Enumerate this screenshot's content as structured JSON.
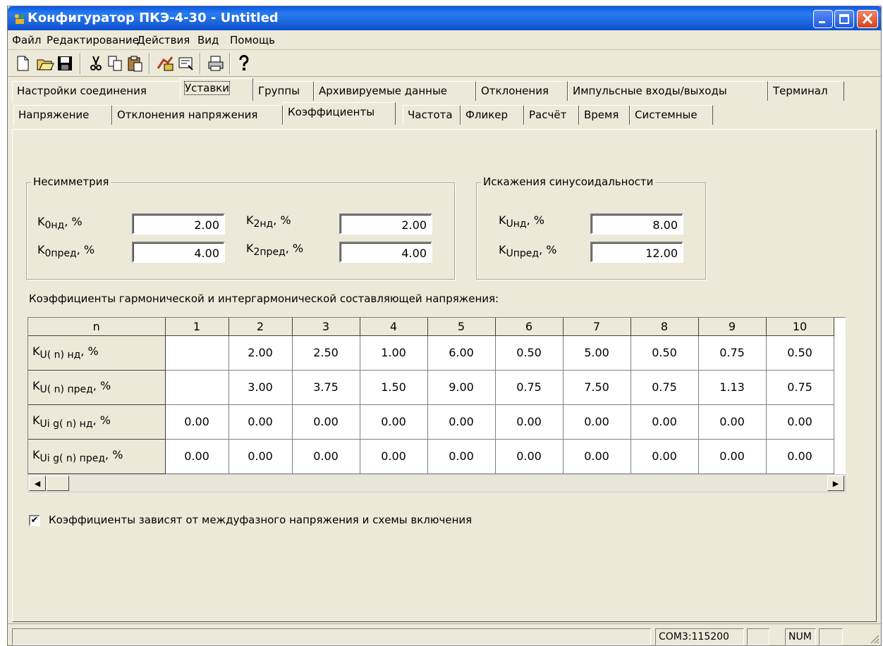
{
  "window": {
    "title": "Конфигуратор ПКЭ-4-30 - Untitled"
  },
  "menu": [
    "Файл",
    "Редактирование",
    "Действия",
    "Вид",
    "Помощь"
  ],
  "toolbar": {
    "icons": [
      "new-file-icon",
      "open-folder-icon",
      "save-icon",
      "cut-icon",
      "copy-icon",
      "paste-icon",
      "connect-icon",
      "read-device-icon",
      "print-icon",
      "help-icon"
    ]
  },
  "tabs_main": [
    "Настройки соединения",
    "Уставки",
    "Группы",
    "Архивируемые данные",
    "Отклонения",
    "Импульсные входы/выходы",
    "Терминал"
  ],
  "tabs_sub": [
    "Напряжение",
    "Отклонения напряжения",
    "Коэффициенты",
    "Частота",
    "Фликер",
    "Расчёт",
    "Время",
    "Системные"
  ],
  "nesim": {
    "caption": "Несимметрия",
    "k0nd": {
      "k": "K",
      "sub": "0нд",
      "unit": ", %",
      "value": "2.00"
    },
    "k0pred": {
      "k": "K",
      "sub": "0пред",
      "unit": ", %",
      "value": "4.00"
    },
    "k2nd": {
      "k": "K",
      "sub": "2нд",
      "unit": ", %",
      "value": "2.00"
    },
    "k2pred": {
      "k": "K",
      "sub": "2пред",
      "unit": ", %",
      "value": "4.00"
    }
  },
  "iskaz": {
    "caption": "Искажения синусоидальности",
    "kund": {
      "k": "K",
      "sub": "Uнд",
      "unit": ", %",
      "value": "8.00"
    },
    "kupred": {
      "k": "K",
      "sub": "Uпред",
      "unit": ", %",
      "value": "12.00"
    }
  },
  "grid": {
    "caption": "Коэффициенты гармонической и интергармонической составляющей напряжения:",
    "corner": "n",
    "columns": [
      "1",
      "2",
      "3",
      "4",
      "5",
      "6",
      "7",
      "8",
      "9",
      "10"
    ],
    "rows": [
      {
        "k": "K",
        "sub": "U( n) нд",
        "unit": ", %",
        "cells": [
          "",
          "2.00",
          "2.50",
          "1.00",
          "6.00",
          "0.50",
          "5.00",
          "0.50",
          "0.75",
          "0.50"
        ]
      },
      {
        "k": "K",
        "sub": "U( n) пред",
        "unit": ", %",
        "cells": [
          "",
          "3.00",
          "3.75",
          "1.50",
          "9.00",
          "0.75",
          "7.50",
          "0.75",
          "1.13",
          "0.75"
        ]
      },
      {
        "k": "K",
        "sub": "Ui g( n) нд",
        "unit": ", %",
        "cells": [
          "0.00",
          "0.00",
          "0.00",
          "0.00",
          "0.00",
          "0.00",
          "0.00",
          "0.00",
          "0.00",
          "0.00"
        ]
      },
      {
        "k": "K",
        "sub": "Ui g( n) пред",
        "unit": ", %",
        "cells": [
          "0.00",
          "0.00",
          "0.00",
          "0.00",
          "0.00",
          "0.00",
          "0.00",
          "0.00",
          "0.00",
          "0.00"
        ]
      }
    ]
  },
  "checkbox": {
    "label": "Коэффициенты зависят от междуфазного напряжения и схемы включения",
    "checked": true,
    "mark": "✔"
  },
  "status": {
    "port": "COM3:115200",
    "num": "NUM"
  }
}
